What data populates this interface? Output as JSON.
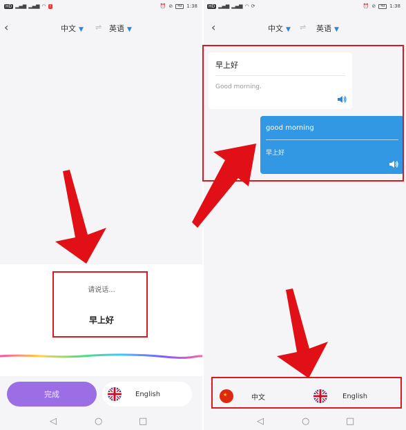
{
  "statusbar": {
    "hd": "HD",
    "time": "1:38",
    "battery": "49"
  },
  "header": {
    "source_lang": "中文",
    "target_lang": "英语",
    "swap_icon": "⇌"
  },
  "left": {
    "prompt": "请说话...",
    "recognized": "早上好",
    "done_label": "完成",
    "lang_chip_label": "English"
  },
  "right": {
    "messages": [
      {
        "source": "早上好",
        "translation": "Good morning."
      },
      {
        "source": "good morning",
        "translation": "早上好"
      }
    ],
    "chip_cn": "中文",
    "chip_en": "English"
  },
  "colors": {
    "accent_blue": "#3298e4",
    "done_purple": "#9b6ee6",
    "annotation_red": "#d9191f"
  },
  "icons": [
    "back-icon",
    "dropdown-icon",
    "swap-icon",
    "speaker-icon",
    "china-flag-icon",
    "uk-flag-icon",
    "nav-back-icon",
    "nav-home-icon",
    "nav-recent-icon"
  ]
}
